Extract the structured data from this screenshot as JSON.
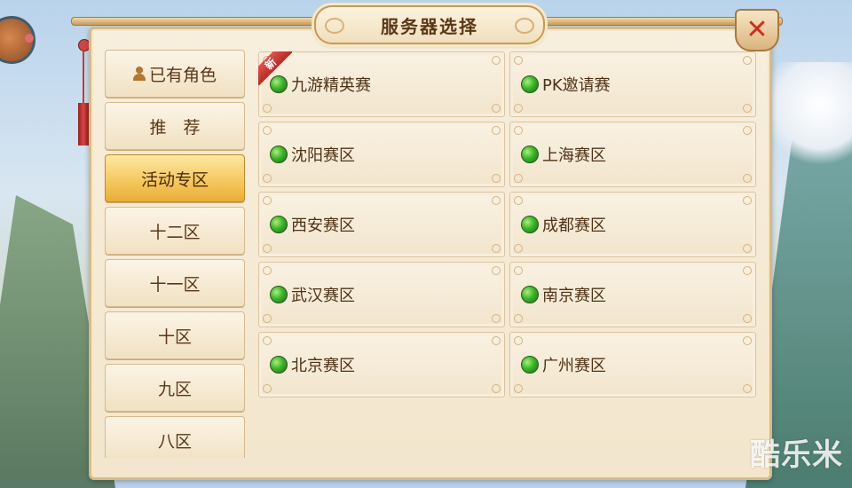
{
  "window": {
    "title": "服务器选择"
  },
  "close_icon": "close-icon",
  "sidebar": {
    "items": [
      {
        "label": "已有角色",
        "icon": "person-icon",
        "active": false
      },
      {
        "label": "推　荐",
        "active": false
      },
      {
        "label": "活动专区",
        "active": true
      },
      {
        "label": "十二区",
        "active": false
      },
      {
        "label": "十一区",
        "active": false
      },
      {
        "label": "十区",
        "active": false
      },
      {
        "label": "九区",
        "active": false
      },
      {
        "label": "八区",
        "active": false
      }
    ]
  },
  "servers": [
    {
      "name": "九游精英赛",
      "badge": "新",
      "status": "online"
    },
    {
      "name": "PK邀请赛",
      "status": "online"
    },
    {
      "name": "沈阳赛区",
      "status": "online"
    },
    {
      "name": "上海赛区",
      "status": "online"
    },
    {
      "name": "西安赛区",
      "status": "online"
    },
    {
      "name": "成都赛区",
      "status": "online"
    },
    {
      "name": "武汉赛区",
      "status": "online"
    },
    {
      "name": "南京赛区",
      "status": "online"
    },
    {
      "name": "北京赛区",
      "status": "online"
    },
    {
      "name": "广州赛区",
      "status": "online"
    }
  ],
  "watermark": "酷乐米",
  "colors": {
    "status_online": "#3bb529",
    "active_tab": "#f4c65a",
    "close_x": "#d8291f",
    "new_badge": "#d23a32"
  }
}
